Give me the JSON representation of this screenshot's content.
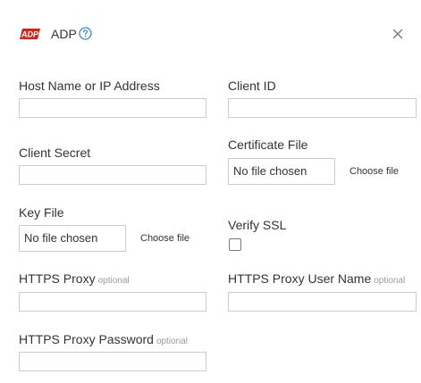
{
  "header": {
    "logo_text": "ADP",
    "title": "ADP",
    "help_icon": "question-circle-icon",
    "close_icon": "close-icon",
    "accent_color": "#d0271d",
    "help_color": "#2a8fd8"
  },
  "form": {
    "host": {
      "label": "Host Name or IP Address",
      "value": ""
    },
    "client_id": {
      "label": "Client ID",
      "value": ""
    },
    "client_secret": {
      "label": "Client Secret",
      "value": ""
    },
    "certificate_file": {
      "label": "Certificate File",
      "status": "No file chosen",
      "button": "Choose file"
    },
    "key_file": {
      "label": "Key File",
      "status": "No file chosen",
      "button": "Choose file"
    },
    "verify_ssl": {
      "label": "Verify SSL",
      "checked": false
    },
    "https_proxy": {
      "label": "HTTPS Proxy",
      "hint": "optional",
      "value": ""
    },
    "https_proxy_user": {
      "label": "HTTPS Proxy User Name",
      "hint": "optional",
      "value": ""
    },
    "https_proxy_password": {
      "label": "HTTPS Proxy Password",
      "hint": "optional",
      "value": ""
    }
  }
}
